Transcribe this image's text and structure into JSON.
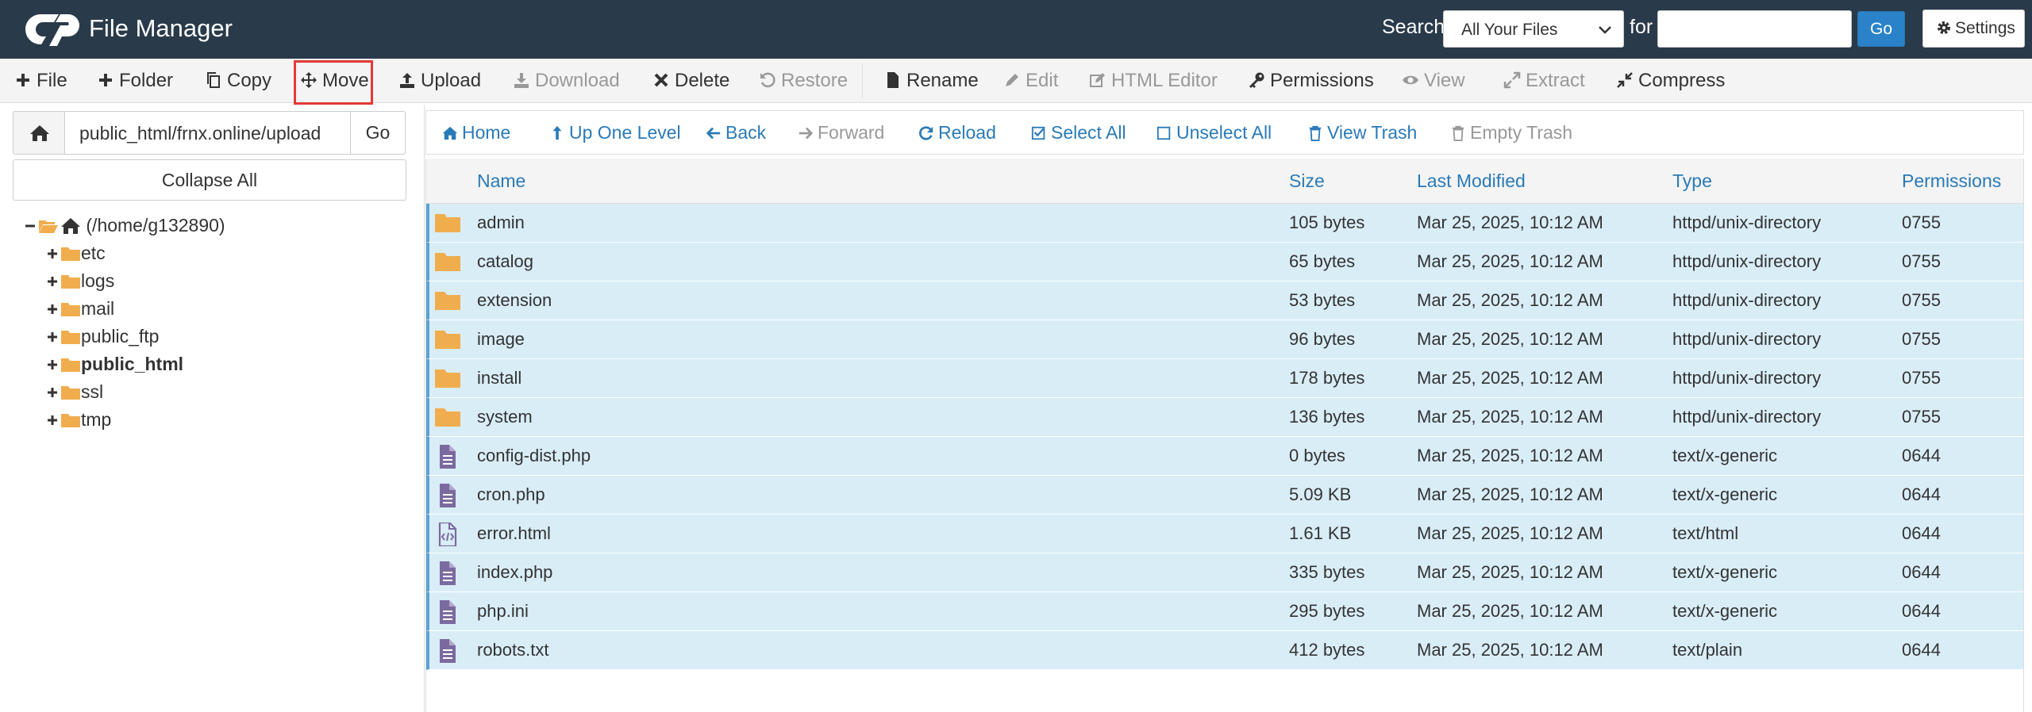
{
  "header": {
    "title": "File Manager",
    "search_label": "Search",
    "search_scope": "All Your Files",
    "for_label": "for",
    "search_value": "",
    "go_label": "Go",
    "settings_label": "Settings"
  },
  "toolbar": {
    "file": "File",
    "folder": "Folder",
    "copy": "Copy",
    "move": "Move",
    "upload": "Upload",
    "download": "Download",
    "delete": "Delete",
    "restore": "Restore",
    "rename": "Rename",
    "edit": "Edit",
    "html_editor": "HTML Editor",
    "permissions": "Permissions",
    "view": "View",
    "extract": "Extract",
    "compress": "Compress"
  },
  "left": {
    "path": "public_html/frnx.online/upload",
    "go_label": "Go",
    "collapse_label": "Collapse All",
    "root_label": "(/home/g132890)",
    "tree": [
      "etc",
      "logs",
      "mail",
      "public_ftp",
      "public_html",
      "ssl",
      "tmp"
    ]
  },
  "nav": {
    "home": "Home",
    "up": "Up One Level",
    "back": "Back",
    "forward": "Forward",
    "reload": "Reload",
    "select_all": "Select All",
    "unselect_all": "Unselect All",
    "view_trash": "View Trash",
    "empty_trash": "Empty Trash"
  },
  "table": {
    "columns": {
      "name": "Name",
      "size": "Size",
      "modified": "Last Modified",
      "type": "Type",
      "permissions": "Permissions"
    },
    "rows": [
      {
        "name": "admin",
        "size": "105 bytes",
        "modified": "Mar 25, 2025, 10:12 AM",
        "type": "httpd/unix-directory",
        "perm": "0755",
        "icon": "folder-icon"
      },
      {
        "name": "catalog",
        "size": "65 bytes",
        "modified": "Mar 25, 2025, 10:12 AM",
        "type": "httpd/unix-directory",
        "perm": "0755",
        "icon": "folder-icon"
      },
      {
        "name": "extension",
        "size": "53 bytes",
        "modified": "Mar 25, 2025, 10:12 AM",
        "type": "httpd/unix-directory",
        "perm": "0755",
        "icon": "folder-icon"
      },
      {
        "name": "image",
        "size": "96 bytes",
        "modified": "Mar 25, 2025, 10:12 AM",
        "type": "httpd/unix-directory",
        "perm": "0755",
        "icon": "folder-icon"
      },
      {
        "name": "install",
        "size": "178 bytes",
        "modified": "Mar 25, 2025, 10:12 AM",
        "type": "httpd/unix-directory",
        "perm": "0755",
        "icon": "folder-icon"
      },
      {
        "name": "system",
        "size": "136 bytes",
        "modified": "Mar 25, 2025, 10:12 AM",
        "type": "httpd/unix-directory",
        "perm": "0755",
        "icon": "folder-icon"
      },
      {
        "name": "config-dist.php",
        "size": "0 bytes",
        "modified": "Mar 25, 2025, 10:12 AM",
        "type": "text/x-generic",
        "perm": "0644",
        "icon": "file-text-icon"
      },
      {
        "name": "cron.php",
        "size": "5.09 KB",
        "modified": "Mar 25, 2025, 10:12 AM",
        "type": "text/x-generic",
        "perm": "0644",
        "icon": "file-text-icon"
      },
      {
        "name": "error.html",
        "size": "1.61 KB",
        "modified": "Mar 25, 2025, 10:12 AM",
        "type": "text/html",
        "perm": "0644",
        "icon": "file-code-icon"
      },
      {
        "name": "index.php",
        "size": "335 bytes",
        "modified": "Mar 25, 2025, 10:12 AM",
        "type": "text/x-generic",
        "perm": "0644",
        "icon": "file-text-icon"
      },
      {
        "name": "php.ini",
        "size": "295 bytes",
        "modified": "Mar 25, 2025, 10:12 AM",
        "type": "text/x-generic",
        "perm": "0644",
        "icon": "file-text-icon"
      },
      {
        "name": "robots.txt",
        "size": "412 bytes",
        "modified": "Mar 25, 2025, 10:12 AM",
        "type": "text/plain",
        "perm": "0644",
        "icon": "file-text-icon"
      }
    ]
  },
  "colors": {
    "header_bg": "#293a4a",
    "link_blue": "#2a7ab8",
    "selected_row": "#d9edf7",
    "folder": "#f0ad4e",
    "file": "#7b6aa0",
    "highlight": "#e53935"
  }
}
